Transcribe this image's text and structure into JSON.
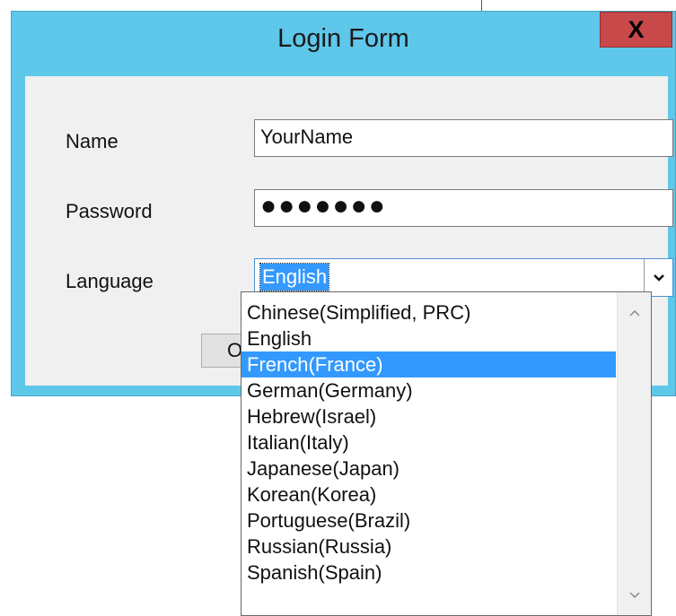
{
  "window": {
    "title": "Login Form",
    "close_label": "X"
  },
  "form": {
    "name_label": "Name",
    "name_value": "YourName",
    "password_label": "Password",
    "password_mask": "●●●●●●●",
    "language_label": "Language",
    "language_value": "English",
    "ok_label": "OK"
  },
  "dropdown": {
    "selected_option": "French(France)",
    "options": [
      "Chinese(Simplified, PRC)",
      "English",
      "French(France)",
      "German(Germany)",
      "Hebrew(Israel)",
      "Italian(Italy)",
      "Japanese(Japan)",
      "Korean(Korea)",
      "Portuguese(Brazil)",
      "Russian(Russia)",
      "Spanish(Spain)"
    ]
  },
  "icons": {
    "close": "close-icon",
    "combo_arrow": "chevron-down-icon",
    "scroll_up": "chevron-up-icon",
    "scroll_down": "chevron-down-icon"
  },
  "colors": {
    "titlebar": "#5ec7ea",
    "close_button": "#c7494a",
    "selection": "#3399ff",
    "client_bg": "#f0f0f0"
  }
}
